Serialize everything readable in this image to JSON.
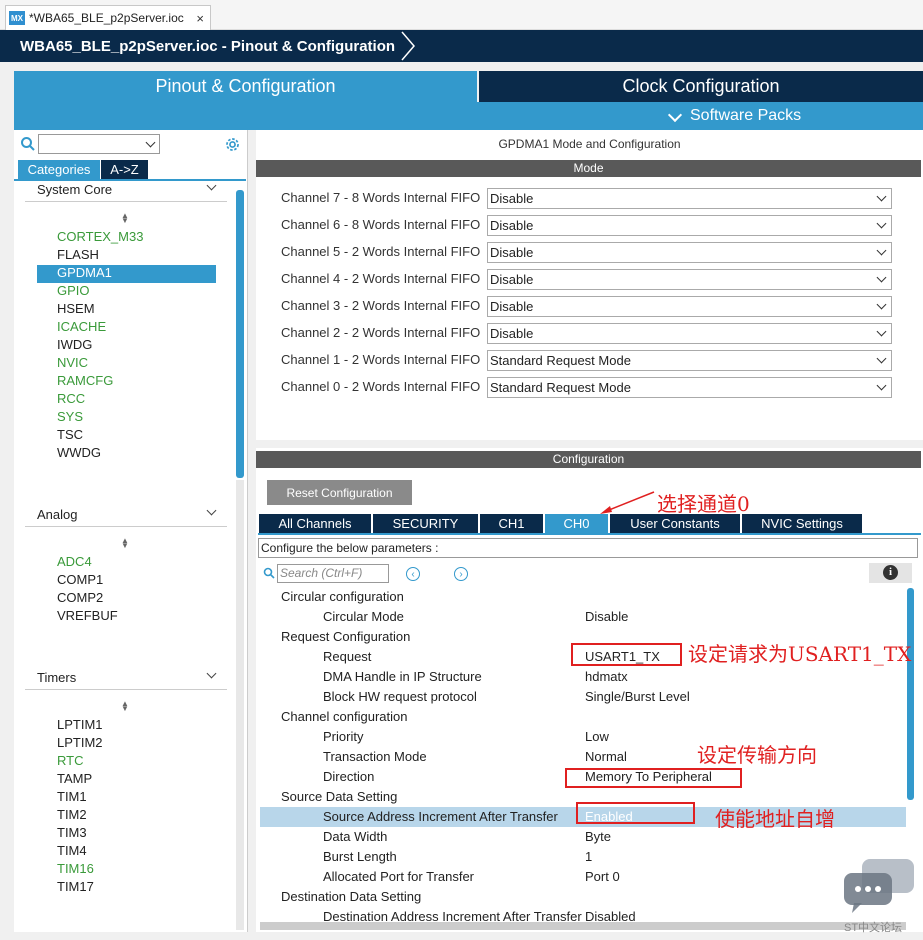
{
  "file_tab": {
    "icon": "MX",
    "title": "*WBA65_BLE_p2pServer.ioc",
    "close": "×"
  },
  "breadcrumb": {
    "item": "WBA65_BLE_p2pServer.ioc - Pinout & Configuration"
  },
  "main_tabs": {
    "pinout": "Pinout & Configuration",
    "clock": "Clock Configuration"
  },
  "software_packs": "Software Packs",
  "left": {
    "tabs": {
      "categories": "Categories",
      "az": "A->Z"
    },
    "groups": [
      {
        "title": "System Core",
        "items": [
          {
            "label": "CORTEX_M33",
            "color": "green"
          },
          {
            "label": "FLASH"
          },
          {
            "label": "GPDMA1",
            "selected": true
          },
          {
            "label": "GPIO",
            "color": "green"
          },
          {
            "label": "HSEM"
          },
          {
            "label": "ICACHE",
            "color": "green"
          },
          {
            "label": "IWDG"
          },
          {
            "label": "NVIC",
            "color": "green"
          },
          {
            "label": "RAMCFG",
            "color": "green"
          },
          {
            "label": "RCC",
            "color": "green"
          },
          {
            "label": "SYS",
            "color": "green"
          },
          {
            "label": "TSC"
          },
          {
            "label": "WWDG"
          }
        ]
      },
      {
        "title": "Analog",
        "items": [
          {
            "label": "ADC4",
            "color": "green"
          },
          {
            "label": "COMP1"
          },
          {
            "label": "COMP2"
          },
          {
            "label": "VREFBUF"
          }
        ]
      },
      {
        "title": "Timers",
        "items": [
          {
            "label": "LPTIM1"
          },
          {
            "label": "LPTIM2"
          },
          {
            "label": "RTC",
            "color": "green"
          },
          {
            "label": "TAMP"
          },
          {
            "label": "TIM1"
          },
          {
            "label": "TIM2"
          },
          {
            "label": "TIM3"
          },
          {
            "label": "TIM4"
          },
          {
            "label": "TIM16",
            "color": "green"
          },
          {
            "label": "TIM17"
          }
        ]
      }
    ]
  },
  "right": {
    "title": "GPDMA1 Mode and Configuration",
    "mode_header": "Mode",
    "channels": [
      {
        "label": "Channel 7  - 8 Words Internal FIFO",
        "value": "Disable"
      },
      {
        "label": "Channel 6  - 8 Words Internal FIFO",
        "value": "Disable"
      },
      {
        "label": "Channel 5  - 2 Words Internal FIFO",
        "value": "Disable"
      },
      {
        "label": "Channel 4  - 2 Words Internal FIFO",
        "value": "Disable"
      },
      {
        "label": "Channel 3  - 2 Words Internal FIFO",
        "value": "Disable"
      },
      {
        "label": "Channel 2  - 2 Words Internal FIFO",
        "value": "Disable"
      },
      {
        "label": "Channel 1  - 2 Words Internal FIFO",
        "value": "Standard Request Mode"
      },
      {
        "label": "Channel 0  - 2 Words Internal FIFO",
        "value": "Standard Request Mode"
      }
    ],
    "config_header": "Configuration",
    "reset_button": "Reset Configuration",
    "config_tabs": [
      "All Channels",
      "SECURITY",
      "CH1",
      "CH0",
      "User Constants",
      "NVIC Settings"
    ],
    "selected_tab": "CH0",
    "param_hint": "Configure the below parameters :",
    "search_placeholder": "Search (Ctrl+F)",
    "params": [
      {
        "key": "Circular configuration",
        "level": 0
      },
      {
        "key": "Circular Mode",
        "value": "Disable",
        "level": 1
      },
      {
        "key": "Request Configuration",
        "level": 0
      },
      {
        "key": "Request",
        "value": "USART1_TX",
        "level": 1
      },
      {
        "key": "DMA Handle in IP Structure",
        "value": "hdmatx",
        "level": 1
      },
      {
        "key": "Block HW request protocol",
        "value": "Single/Burst Level",
        "level": 1
      },
      {
        "key": "Channel configuration",
        "level": 0
      },
      {
        "key": "Priority",
        "value": "Low",
        "level": 1
      },
      {
        "key": "Transaction Mode",
        "value": "Normal",
        "level": 1
      },
      {
        "key": "Direction",
        "value": "Memory To Peripheral",
        "level": 1
      },
      {
        "key": "Source Data Setting",
        "level": 0
      },
      {
        "key": "Source Address Increment After Transfer",
        "value": "Enabled",
        "level": 1,
        "highlight": true
      },
      {
        "key": "Data Width",
        "value": "Byte",
        "level": 1
      },
      {
        "key": "Burst Length",
        "value": "1",
        "level": 1
      },
      {
        "key": "Allocated Port for Transfer",
        "value": "Port 0",
        "level": 1
      },
      {
        "key": "Destination Data Setting",
        "level": 0
      },
      {
        "key": "Destination Address Increment After Transfer",
        "value": "Disabled",
        "level": 1
      }
    ]
  },
  "annotations": {
    "select_channel": "选择通道0",
    "set_request": "设定请求为USART1_TX",
    "set_direction": "设定传输方向",
    "enable_increment": "使能地址自增"
  },
  "watermark": "ST中文论坛",
  "colors": {
    "accent": "#3399cc",
    "navy": "#0a2a4a",
    "green": "#3a9a3a",
    "annotation": "#e02020"
  }
}
